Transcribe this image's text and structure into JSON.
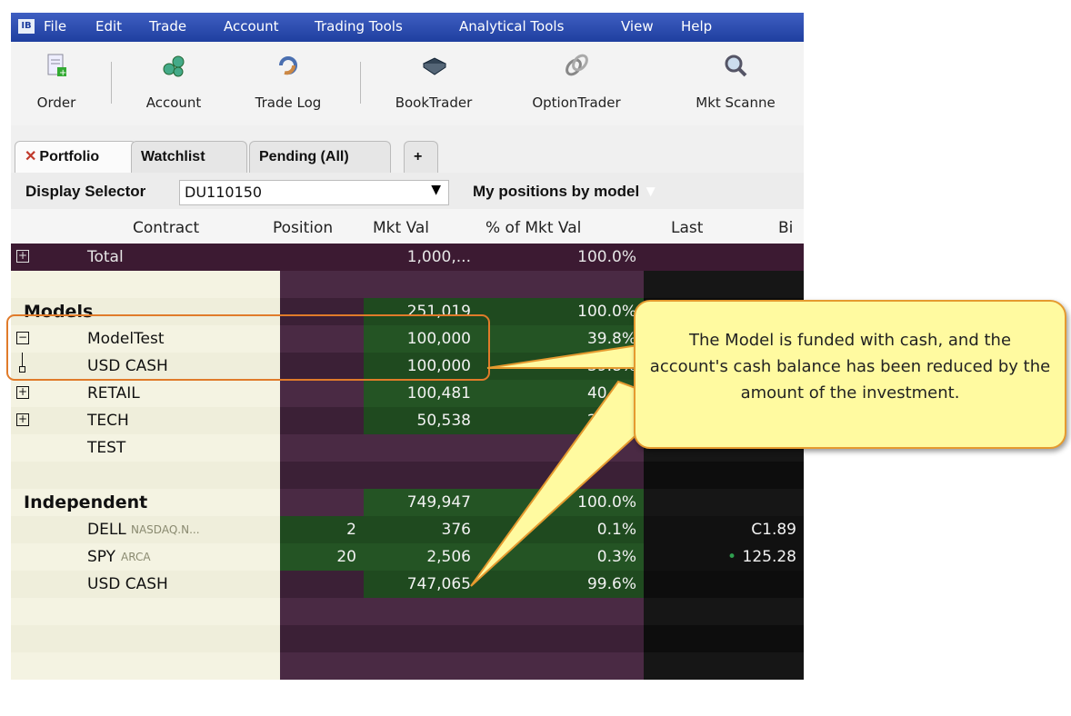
{
  "menu": [
    "File",
    "Edit",
    "Trade",
    "Account",
    "Trading Tools",
    "Analytical Tools",
    "View",
    "Help"
  ],
  "app_icon": "IB",
  "toolbar": [
    {
      "label": "Order",
      "icon": "order-icon"
    },
    {
      "label": "Account",
      "icon": "account-icon"
    },
    {
      "label": "Trade Log",
      "icon": "trade-log-icon"
    },
    {
      "label": "BookTrader",
      "icon": "booktrader-icon"
    },
    {
      "label": "OptionTrader",
      "icon": "optiontrader-icon"
    },
    {
      "label": "Mkt Scanne",
      "icon": "mkt-scanner-icon"
    }
  ],
  "tabs": [
    "Portfolio",
    "Watchlist",
    "Pending (All)",
    "+"
  ],
  "display_selector": {
    "label": "Display Selector",
    "value": "DU110150",
    "view": "My positions by model"
  },
  "columns": [
    "Contract",
    "Position",
    "Mkt Val",
    "% of Mkt Val",
    "Last",
    "Bi"
  ],
  "rows": [
    {
      "contract": "Total",
      "position": "",
      "mktval": "1,000,...",
      "pct": "100.0%",
      "last": "",
      "type": "total",
      "expand": "+"
    },
    {
      "contract": "",
      "position": "",
      "mktval": "",
      "pct": "",
      "last": "",
      "type": "blank"
    },
    {
      "contract": "Models",
      "position": "",
      "mktval": "251,019",
      "pct": "100.0%",
      "last": "",
      "type": "section"
    },
    {
      "contract": "ModelTest",
      "position": "",
      "mktval": "100,000",
      "pct": "39.8%",
      "last": "",
      "type": "item",
      "expand": "-"
    },
    {
      "contract": "USD CASH",
      "position": "",
      "mktval": "100,000",
      "pct": "39.8%",
      "last": "",
      "type": "child"
    },
    {
      "contract": "RETAIL",
      "position": "",
      "mktval": "100,481",
      "pct": "40.0%",
      "last": "",
      "type": "item",
      "expand": "+"
    },
    {
      "contract": "TECH",
      "position": "",
      "mktval": "50,538",
      "pct": "20.1%",
      "last": "",
      "type": "item",
      "expand": "+"
    },
    {
      "contract": "TEST",
      "position": "",
      "mktval": "",
      "pct": "",
      "last": "",
      "type": "item"
    },
    {
      "contract": "",
      "position": "",
      "mktval": "",
      "pct": "",
      "last": "",
      "type": "blank"
    },
    {
      "contract": "Independent",
      "position": "",
      "mktval": "749,947",
      "pct": "100.0%",
      "last": "",
      "type": "section"
    },
    {
      "contract": "DELL",
      "exchange": "NASDAQ.N...",
      "position": "2",
      "mktval": "376",
      "pct": "0.1%",
      "last": "C1.89",
      "type": "item"
    },
    {
      "contract": "SPY",
      "exchange": "ARCA",
      "position": "20",
      "mktval": "2,506",
      "pct": "0.3%",
      "last": "125.28",
      "type": "item",
      "dot": true
    },
    {
      "contract": "USD CASH",
      "position": "",
      "mktval": "747,065",
      "pct": "99.6%",
      "last": "",
      "type": "item"
    },
    {
      "contract": "",
      "position": "",
      "mktval": "",
      "pct": "",
      "last": "",
      "type": "blank"
    },
    {
      "contract": "",
      "position": "",
      "mktval": "",
      "pct": "",
      "last": "",
      "type": "blank"
    },
    {
      "contract": "",
      "position": "",
      "mktval": "",
      "pct": "",
      "last": "",
      "type": "blank"
    }
  ],
  "callout": "The Model is funded with cash, and the account's cash balance has been reduced by the amount of the investment.",
  "colors": {
    "menubar": "#2a4bb0",
    "total_row": "#3a1830",
    "green_cell": "#1f4c1f",
    "last_cell": "#0f0f0f",
    "callout_bg": "#fffaa0",
    "callout_border": "#e59a2f"
  }
}
